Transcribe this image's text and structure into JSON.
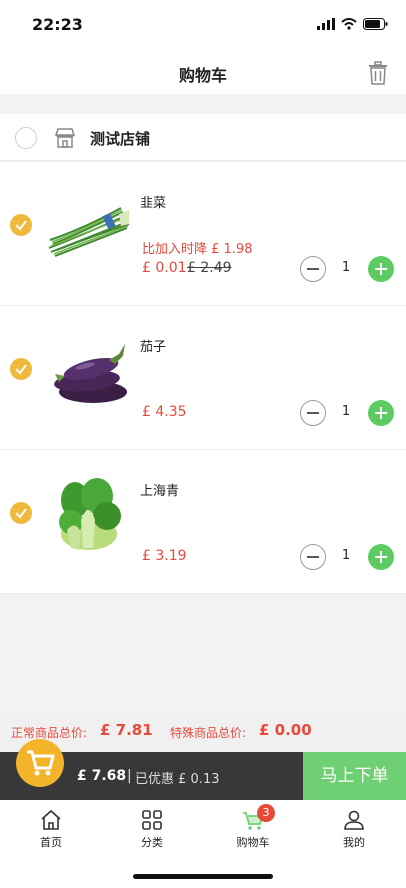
{
  "status_bar": {
    "time": "22:23"
  },
  "nav": {
    "title": "购物车",
    "trash_icon": "trash-icon"
  },
  "store": {
    "name": "测试店铺",
    "selected": false
  },
  "items": [
    {
      "name": "韭菜",
      "price_drop": "比加入时降 £ 1.98",
      "price": "£ 0.01",
      "original_price": "£ 2.49",
      "qty": "1",
      "checked": true
    },
    {
      "name": "茄子",
      "price": "£ 4.35",
      "qty": "1",
      "checked": true
    },
    {
      "name": "上海青",
      "price": "£ 3.19",
      "qty": "1",
      "checked": true
    }
  ],
  "totals": {
    "normal_label": "正常商品总价:",
    "normal_value": "£ 7.81",
    "special_label": "特殊商品总价:",
    "special_value": "£ 0.00"
  },
  "checkout": {
    "amount": "£ 7.68",
    "separator": "|",
    "discount": "已优惠 £ 0.13",
    "order_button": "马上下单"
  },
  "tabbar": [
    {
      "label": "首页",
      "icon": "home-icon"
    },
    {
      "label": "分类",
      "icon": "category-icon"
    },
    {
      "label": "购物车",
      "icon": "cart-icon",
      "badge": "3",
      "active": true
    },
    {
      "label": "我的",
      "icon": "user-icon"
    }
  ],
  "colors": {
    "accent_red": "#e64a3b",
    "check_yellow": "#efb93a",
    "green": "#5dcb62",
    "checkout_bg": "#383838"
  }
}
